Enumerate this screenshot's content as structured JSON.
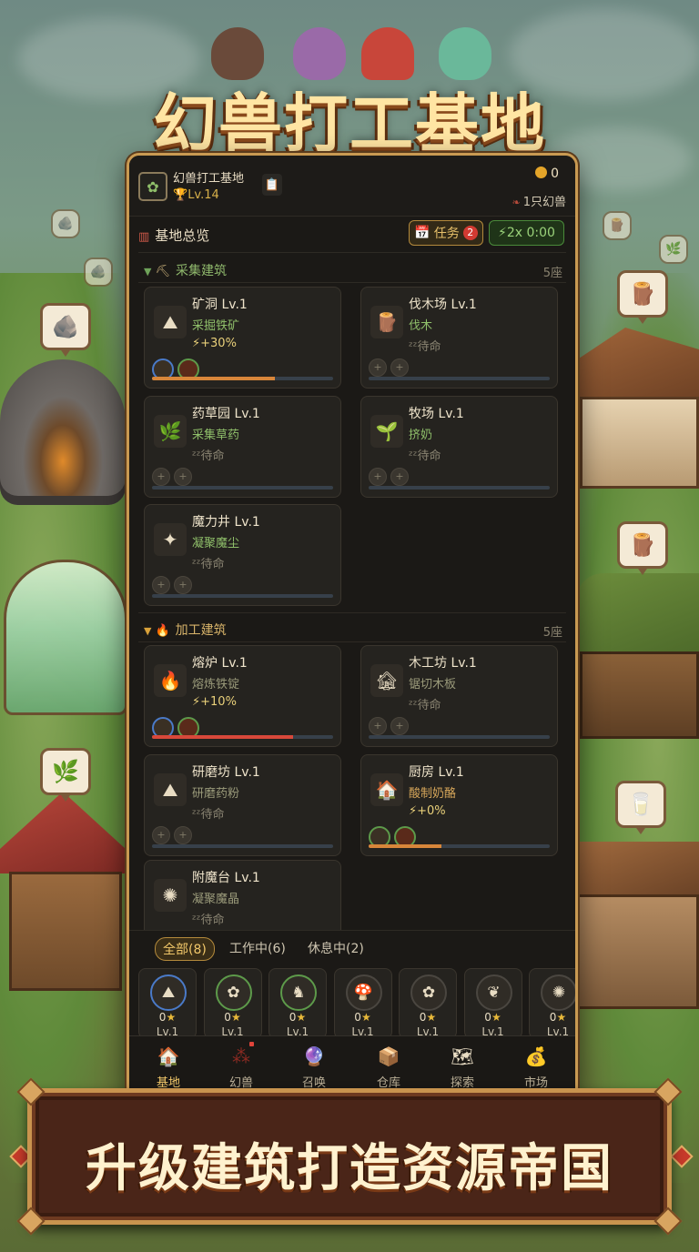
{
  "title": "幻兽打工基地",
  "banner": "升级建筑打造资源帝国",
  "header": {
    "base_name": "幻兽打工基地",
    "base_level": "Lv.14",
    "gold": "0",
    "beast_count": "1只幻兽"
  },
  "overview": {
    "title": "基地总览",
    "task_label": "任务",
    "task_badge": "2",
    "speed_label": "2x 0:00"
  },
  "sections": {
    "gather": {
      "name": "采集建筑",
      "count": "5座",
      "buildings": [
        {
          "name": "矿洞 Lv.1",
          "action": "采掘铁矿",
          "status": "⚡+30%",
          "progress": 0.68,
          "icon": "ore-icon"
        },
        {
          "name": "伐木场 Lv.1",
          "action": "伐木",
          "status": "ᶻᶻ待命",
          "progress": 0,
          "icon": "log-icon"
        },
        {
          "name": "药草园 Lv.1",
          "action": "采集草药",
          "status": "ᶻᶻ待命",
          "progress": 0,
          "icon": "herb-icon"
        },
        {
          "name": "牧场 Lv.1",
          "action": "挤奶",
          "status": "ᶻᶻ待命",
          "progress": 0,
          "icon": "ranch-icon"
        },
        {
          "name": "魔力井 Lv.1",
          "action": "凝聚魔尘",
          "status": "ᶻᶻ待命",
          "progress": 0,
          "icon": "well-icon"
        }
      ]
    },
    "process": {
      "name": "加工建筑",
      "count": "5座",
      "buildings": [
        {
          "name": "熔炉 Lv.1",
          "action": "熔炼铁锭",
          "status": "⚡+10%",
          "progress": 0.78,
          "icon": "furnace-icon"
        },
        {
          "name": "木工坊 Lv.1",
          "action": "锯切木板",
          "status": "ᶻᶻ待命",
          "progress": 0,
          "icon": "workshop-icon"
        },
        {
          "name": "研磨坊 Lv.1",
          "action": "研磨药粉",
          "status": "ᶻᶻ待命",
          "progress": 0,
          "icon": "mill-icon"
        },
        {
          "name": "厨房 Lv.1",
          "action": "酸制奶酪",
          "status": "⚡+0%",
          "progress": 0.4,
          "icon": "kitchen-icon"
        },
        {
          "name": "附魔台 Lv.1",
          "action": "凝聚魔晶",
          "status": "ᶻᶻ待命",
          "progress": 0,
          "icon": "enchant-icon"
        }
      ]
    }
  },
  "filters": [
    "全部(8)",
    "工作中(6)",
    "休息中(2)"
  ],
  "beasts": [
    {
      "stars": "0",
      "level": "Lv.1",
      "ring": "#4a7ac8"
    },
    {
      "stars": "0",
      "level": "Lv.1",
      "ring": "#5d9a4a"
    },
    {
      "stars": "0",
      "level": "Lv.1",
      "ring": "#5d9a4a"
    },
    {
      "stars": "0",
      "level": "Lv.1",
      "ring": "#4a4640"
    },
    {
      "stars": "0",
      "level": "Lv.1",
      "ring": "#4a4640"
    },
    {
      "stars": "0",
      "level": "Lv.1",
      "ring": "#4a4640"
    },
    {
      "stars": "0",
      "level": "Lv.1",
      "ring": "#4a4640"
    }
  ],
  "nav": [
    "基地",
    "幻兽",
    "召唤",
    "仓库",
    "探索",
    "市场"
  ],
  "colors": {
    "accent_gold": "#f2c86a",
    "panel_bg": "#1b1916",
    "gather_green": "#8fbf6a",
    "progress_orange": "#d8863a",
    "progress_red": "#d8483a"
  }
}
